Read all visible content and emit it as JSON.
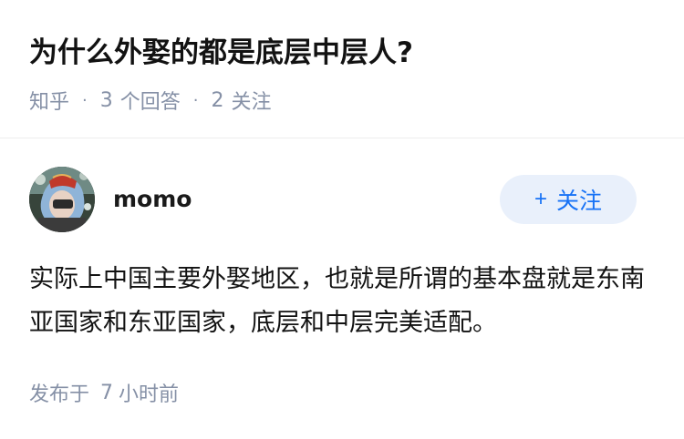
{
  "question": {
    "title": "为什么外娶的都是底层中层人?",
    "source": "知乎",
    "answer_count": "3",
    "answer_label": "个回答",
    "follower_count": "2",
    "follower_label": "关注"
  },
  "answer": {
    "author_name": "momo",
    "follow_button_label": "关注",
    "follow_button_icon": "plus-icon",
    "content": "实际上中国主要外娶地区，也就是所谓的基本盘就是东南亚国家和东亚国家，底层和中层完美适配。",
    "posted_label": "发布于",
    "posted_amount": "7",
    "posted_unit": "小时前"
  },
  "colors": {
    "accent": "#1772f6",
    "follow_button_bg": "#e9f0fb",
    "meta_text": "#8590a6",
    "title_text": "#121212"
  }
}
